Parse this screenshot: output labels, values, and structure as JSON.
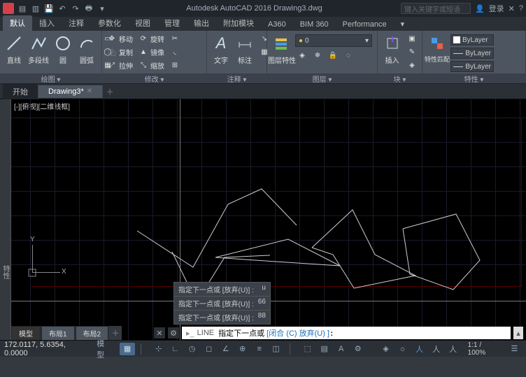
{
  "title": "Autodesk AutoCAD 2016   Drawing3.dwg",
  "search_placeholder": "键入关键字或短语",
  "login": "登录",
  "ribbonTabs": [
    "默认",
    "插入",
    "注释",
    "参数化",
    "视图",
    "管理",
    "输出",
    "附加模块",
    "A360",
    "BIM 360",
    "Performance"
  ],
  "ribbonTabs_dd": "▾",
  "panels": {
    "draw": {
      "title": "绘图 ▾",
      "line": "直线",
      "polyline": "多段线",
      "circle": "圆",
      "arc": "圆弧"
    },
    "modify": {
      "title": "修改 ▾",
      "move": "移动",
      "rotate": "旋转",
      "copy": "复制",
      "mirror": "镜像",
      "stretch": "拉伸",
      "scale": "缩放"
    },
    "annot": {
      "title": "注释 ▾",
      "text": "文字",
      "dim": "标注"
    },
    "layers": {
      "title": "图层 ▾",
      "props": "图层特性",
      "drop": "0"
    },
    "block": {
      "title": "块 ▾",
      "insert": "插入"
    },
    "props": {
      "title": "特性 ▾",
      "match": "特性匹配",
      "bylayer": "ByLayer"
    }
  },
  "fileTabs": {
    "start": "开始",
    "drawing": "Drawing3*"
  },
  "viewport_label": "[-][俯视][二维线框]",
  "sidebar_label": "特性",
  "ucs": {
    "x": "X",
    "y": "Y"
  },
  "cmdhist": [
    {
      "t": "指定下一点或 [放弃(U)] :",
      "v": "u"
    },
    {
      "t": "指定下一点或 [放弃(U)] :",
      "v": "66"
    },
    {
      "t": "指定下一点或 [放弃(U)] :",
      "v": "88"
    }
  ],
  "cmdline": {
    "kw": "LINE",
    "prompt": "指定下一点或",
    "opts": "[闭合 (C) 放弃(U) ]"
  },
  "modelTabs": {
    "model": "模型",
    "layout1": "布局1",
    "layout2": "布局2"
  },
  "status": {
    "coords": "172.0117, 5.6354, 0.0000",
    "model": "模型",
    "scale": "1:1 / 100%"
  }
}
